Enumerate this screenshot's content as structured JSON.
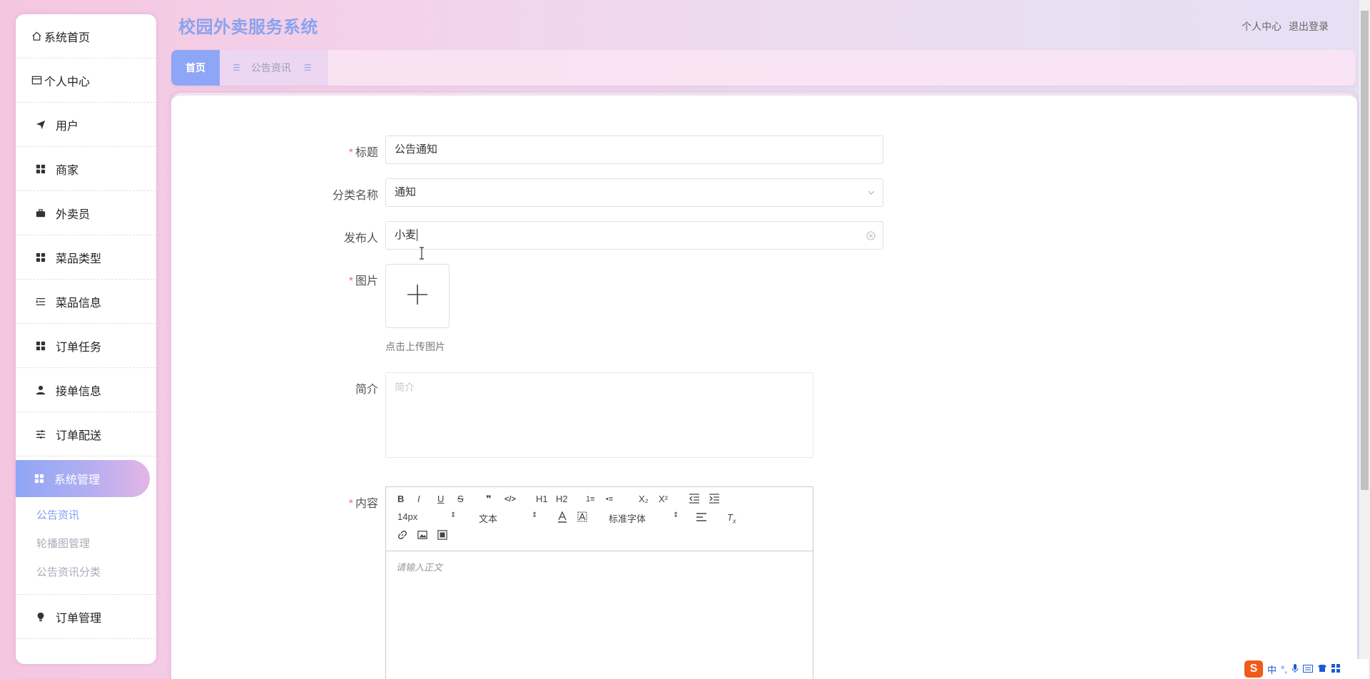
{
  "app": {
    "title": "校园外卖服务系统"
  },
  "header": {
    "personal_center": "个人中心",
    "logout": "退出登录"
  },
  "sidebar": {
    "items": [
      {
        "label": "系统首页",
        "icon": "home-icon"
      },
      {
        "label": "个人中心",
        "icon": "card-icon"
      },
      {
        "label": "用户",
        "icon": "send-icon"
      },
      {
        "label": "商家",
        "icon": "grid-icon"
      },
      {
        "label": "外卖员",
        "icon": "briefcase-icon"
      },
      {
        "label": "菜品类型",
        "icon": "grid-icon"
      },
      {
        "label": "菜品信息",
        "icon": "list-icon"
      },
      {
        "label": "订单任务",
        "icon": "grid-icon"
      },
      {
        "label": "接单信息",
        "icon": "user-icon"
      },
      {
        "label": "订单配送",
        "icon": "sliders-icon"
      },
      {
        "label": "系统管理",
        "icon": "grid-icon"
      },
      {
        "label": "订单管理",
        "icon": "bulb-icon"
      }
    ],
    "submenu": [
      "公告资讯",
      "轮播图管理",
      "公告资讯分类"
    ]
  },
  "tabs": {
    "home": "首页",
    "notice": "公告资讯"
  },
  "form": {
    "title_label": "标题",
    "title_value": "公告通知",
    "category_label": "分类名称",
    "category_value": "通知",
    "publisher_label": "发布人",
    "publisher_value": "小麦",
    "image_label": "图片",
    "upload_tip": "点击上传图片",
    "intro_label": "简介",
    "intro_placeholder": "简介",
    "content_label": "内容",
    "content_placeholder": "请输入正文"
  },
  "editor": {
    "font_size": "14px",
    "heading": "文本",
    "font_family": "标准字体",
    "buttons": [
      "B",
      "I",
      "U",
      "S",
      "❞",
      "</>",
      "H1",
      "H2",
      "1≡",
      "•≡",
      "X₂",
      "X²"
    ]
  },
  "ime": {
    "mode": "中",
    "logo": "S"
  },
  "colors": {
    "accent": "#8ea6f6",
    "required": "#f56c6c",
    "title": "#8aa3ee"
  }
}
